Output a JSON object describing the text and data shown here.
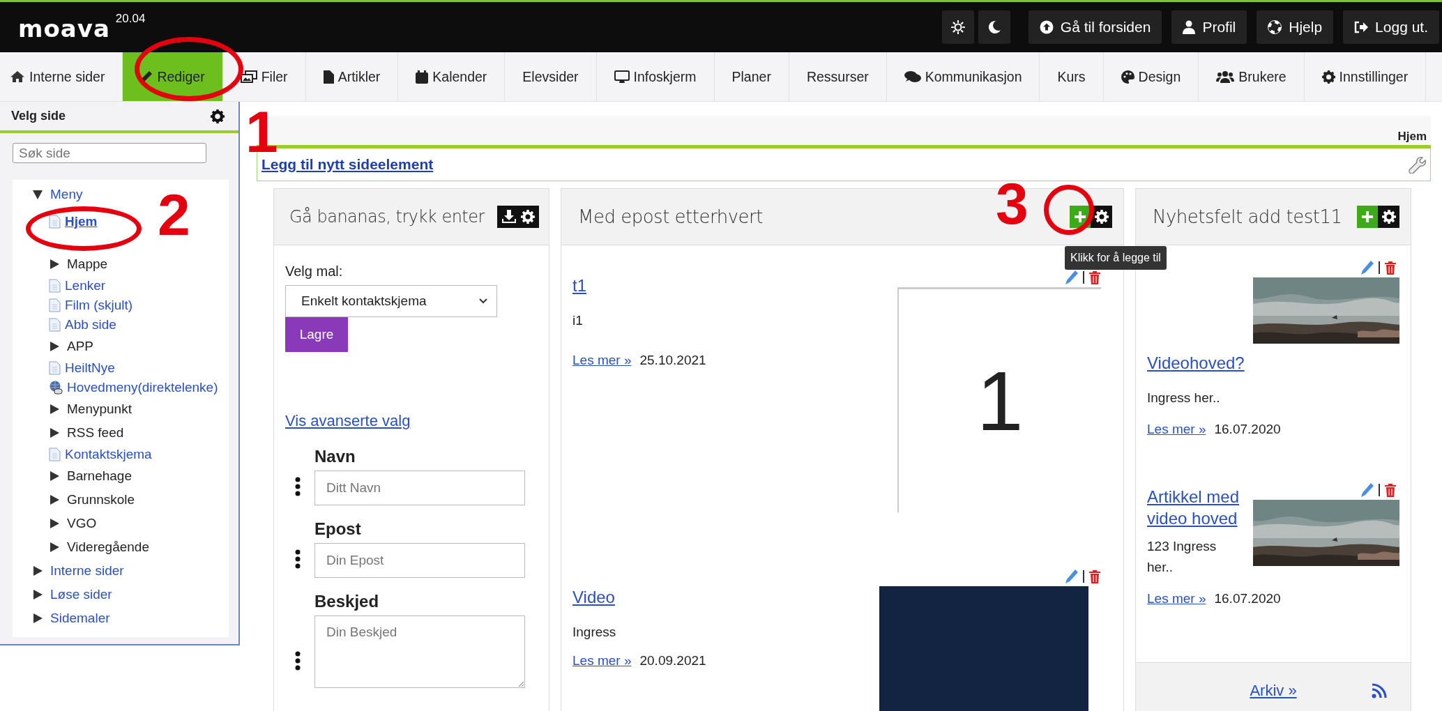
{
  "topbar": {
    "logo": "moava",
    "version": "20.04",
    "buttons": [
      "Gå til forsiden",
      "Profil",
      "Hjelp",
      "Logg ut."
    ]
  },
  "nav": [
    {
      "label": "Interne sider",
      "selected": false
    },
    {
      "label": "Rediger",
      "selected": true
    },
    {
      "label": "Filer",
      "selected": false
    },
    {
      "label": "Artikler",
      "selected": false
    },
    {
      "label": "Kalender",
      "selected": false
    },
    {
      "label": "Elevsider",
      "selected": false
    },
    {
      "label": "Infoskjerm",
      "selected": false
    },
    {
      "label": "Planer",
      "selected": false
    },
    {
      "label": "Ressurser",
      "selected": false
    },
    {
      "label": "Kommunikasjon",
      "selected": false
    },
    {
      "label": "Kurs",
      "selected": false
    },
    {
      "label": "Design",
      "selected": false
    },
    {
      "label": "Brukere",
      "selected": false
    },
    {
      "label": "Innstillinger",
      "selected": false
    }
  ],
  "sidebar": {
    "title": "Velg side",
    "search": {
      "placeholder": "Søk side"
    },
    "tree": [
      {
        "label": "Meny",
        "kind": "folder",
        "expanded": true,
        "children": [
          {
            "label": "Hjem",
            "kind": "page",
            "selected": true
          },
          {
            "label": "Mappe",
            "kind": "folder",
            "expanded": false
          },
          {
            "label": "Lenker",
            "kind": "page",
            "selected": false
          },
          {
            "label": "Film (skjult)",
            "kind": "page",
            "selected": false
          },
          {
            "label": "Abb side",
            "kind": "page",
            "selected": false
          },
          {
            "label": "APP",
            "kind": "folder",
            "expanded": false
          },
          {
            "label": "HeiltNye",
            "kind": "page",
            "selected": false
          },
          {
            "label": "Hovedmeny(direktelenke)",
            "kind": "link",
            "selected": false
          },
          {
            "label": "Menypunkt",
            "kind": "folder",
            "expanded": false
          },
          {
            "label": "RSS feed",
            "kind": "folder",
            "expanded": false
          },
          {
            "label": "Kontaktskjema",
            "kind": "page",
            "selected": false
          },
          {
            "label": "Barnehage",
            "kind": "folder",
            "expanded": false
          },
          {
            "label": "Grunnskole",
            "kind": "folder",
            "expanded": false
          },
          {
            "label": "VGO",
            "kind": "folder",
            "expanded": false
          },
          {
            "label": "Videregående",
            "kind": "folder",
            "expanded": false
          }
        ]
      },
      {
        "label": "Interne sider",
        "kind": "folder",
        "expanded": false
      },
      {
        "label": "Løse sider",
        "kind": "folder",
        "expanded": false
      },
      {
        "label": "Sidemaler",
        "kind": "folder",
        "expanded": false
      }
    ]
  },
  "main": {
    "page_title": "Hjem",
    "add_element": "Legg til nytt sideelement",
    "columns": [
      {
        "kind": "form",
        "title": "Gå bananas, trykk enter",
        "template_label": "Velg mal:",
        "template_value": "Enkelt kontaktskjema",
        "save": "Lagre",
        "advanced": "Vis avanserte valg",
        "fields": [
          {
            "label": "Navn",
            "placeholder": "Ditt Navn",
            "kind": "input"
          },
          {
            "label": "Epost",
            "placeholder": "Din Epost",
            "kind": "input"
          },
          {
            "label": "Beskjed",
            "placeholder": "Din Beskjed",
            "kind": "textarea"
          }
        ]
      },
      {
        "kind": "articles",
        "title": "Med epost etterhvert",
        "items": [
          {
            "title": "t1",
            "ingress": "i1",
            "more": "Les mer »",
            "date": "25.10.2021",
            "media": {
              "kind": "number",
              "text": "1"
            }
          },
          {
            "title": "Video",
            "ingress": "Ingress",
            "more": "Les mer »",
            "date": "20.09.2021",
            "media": {
              "kind": "video"
            }
          }
        ]
      },
      {
        "kind": "news",
        "title": "Nyhetsfelt add test11",
        "items": [
          {
            "title": "Videohoved?",
            "ingress": "Ingress her..",
            "more": "Les mer »",
            "date": "16.07.2020"
          },
          {
            "title": "Artikkel med video hoved",
            "ingress": "123 Ingress her..",
            "more": "Les mer »",
            "date": "16.07.2020"
          }
        ],
        "archive": "Arkiv »"
      }
    ]
  },
  "tooltip": "Klikk for å legge til",
  "annotations": [
    {
      "number": "1"
    },
    {
      "number": "2"
    },
    {
      "number": "3"
    }
  ]
}
